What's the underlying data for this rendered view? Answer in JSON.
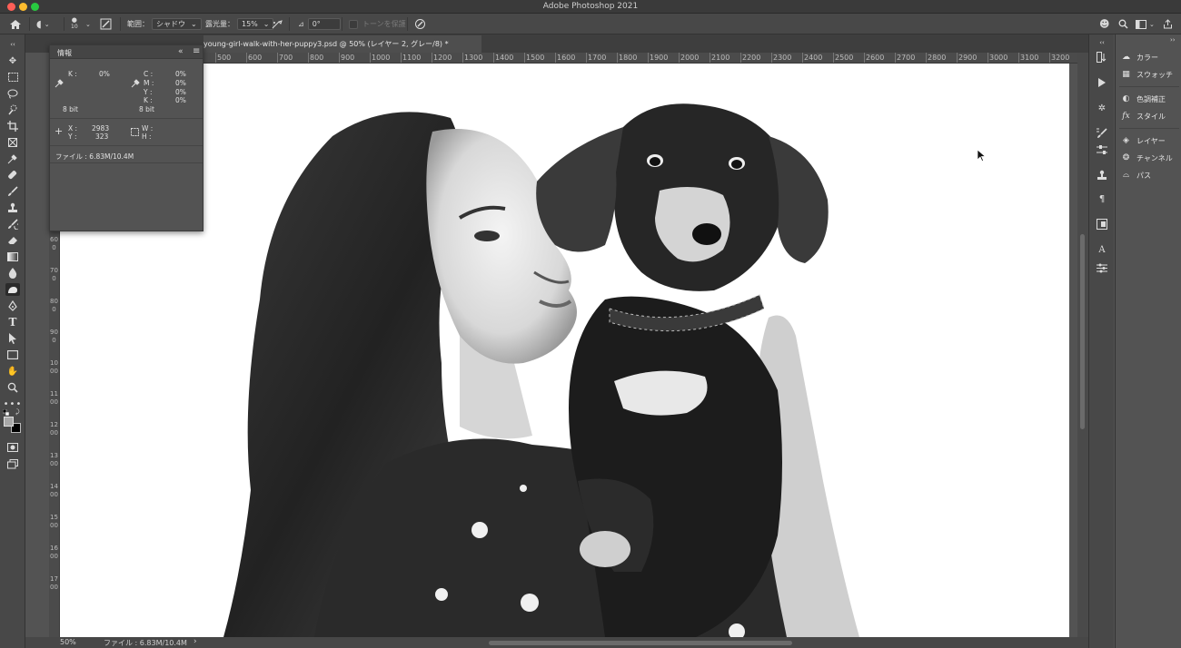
{
  "app": {
    "window_title": "Adobe Photoshop 2021",
    "traffic_lights": {
      "close": "#ff5f57",
      "minimize": "#febc2e",
      "maximize": "#28c840"
    }
  },
  "options_bar": {
    "home_icon": "home-icon",
    "brush_size": "10",
    "range_label": "範囲：",
    "range_value": "シャドウ",
    "exposure_label": "露光量：",
    "exposure_value": "15%",
    "angle_value": "0°",
    "protect_tones_label": "トーンを保護"
  },
  "document_tab": {
    "title": "young-girl-walk-with-her-puppy3.psd @ 50% (レイヤー 2, グレー/8) *"
  },
  "ruler": {
    "horizontal_labels": [
      "500",
      "600",
      "700",
      "800",
      "900",
      "1000",
      "1100",
      "1200",
      "1300",
      "1400",
      "1500",
      "1600",
      "1700",
      "1800",
      "1900",
      "2000",
      "2100",
      "2200",
      "2300",
      "2400",
      "2500",
      "2600",
      "2700",
      "2800",
      "2900",
      "3000",
      "3100",
      "3200"
    ],
    "vertical_labels": [
      "600",
      "700",
      "800",
      "900",
      "1000",
      "1100",
      "1200",
      "1300",
      "1400",
      "1500",
      "1600",
      "1700"
    ]
  },
  "info_panel": {
    "title": "情報",
    "k_label": "K :",
    "k_value": "0%",
    "c_label": "C :",
    "c_value": "0%",
    "m_label": "M :",
    "m_value": "0%",
    "y_label": "Y :",
    "y_value": "0%",
    "k2_label": "K :",
    "k2_value": "0%",
    "bitdepth_left": "8 bit",
    "bitdepth_right": "8 bit",
    "x_label": "X :",
    "x_value": "2983",
    "y_coord_label": "Y :",
    "y_coord_value": "323",
    "w_label": "W :",
    "h_label": "H :",
    "file_info": "ファイル : 6.83M/10.4M"
  },
  "status_bar": {
    "zoom": "50%",
    "file_info": "ファイル : 6.83M/10.4M"
  },
  "right_panels": [
    {
      "label": "カラー",
      "icon": "color-wheel-icon"
    },
    {
      "label": "スウォッチ",
      "icon": "swatches-grid-icon"
    },
    {
      "label": "色調補正",
      "icon": "adjustments-circle-icon"
    },
    {
      "label": "スタイル",
      "icon": "fx-icon"
    },
    {
      "label": "レイヤー",
      "icon": "layers-icon"
    },
    {
      "label": "チャンネル",
      "icon": "channels-icon"
    },
    {
      "label": "パス",
      "icon": "paths-icon"
    }
  ]
}
